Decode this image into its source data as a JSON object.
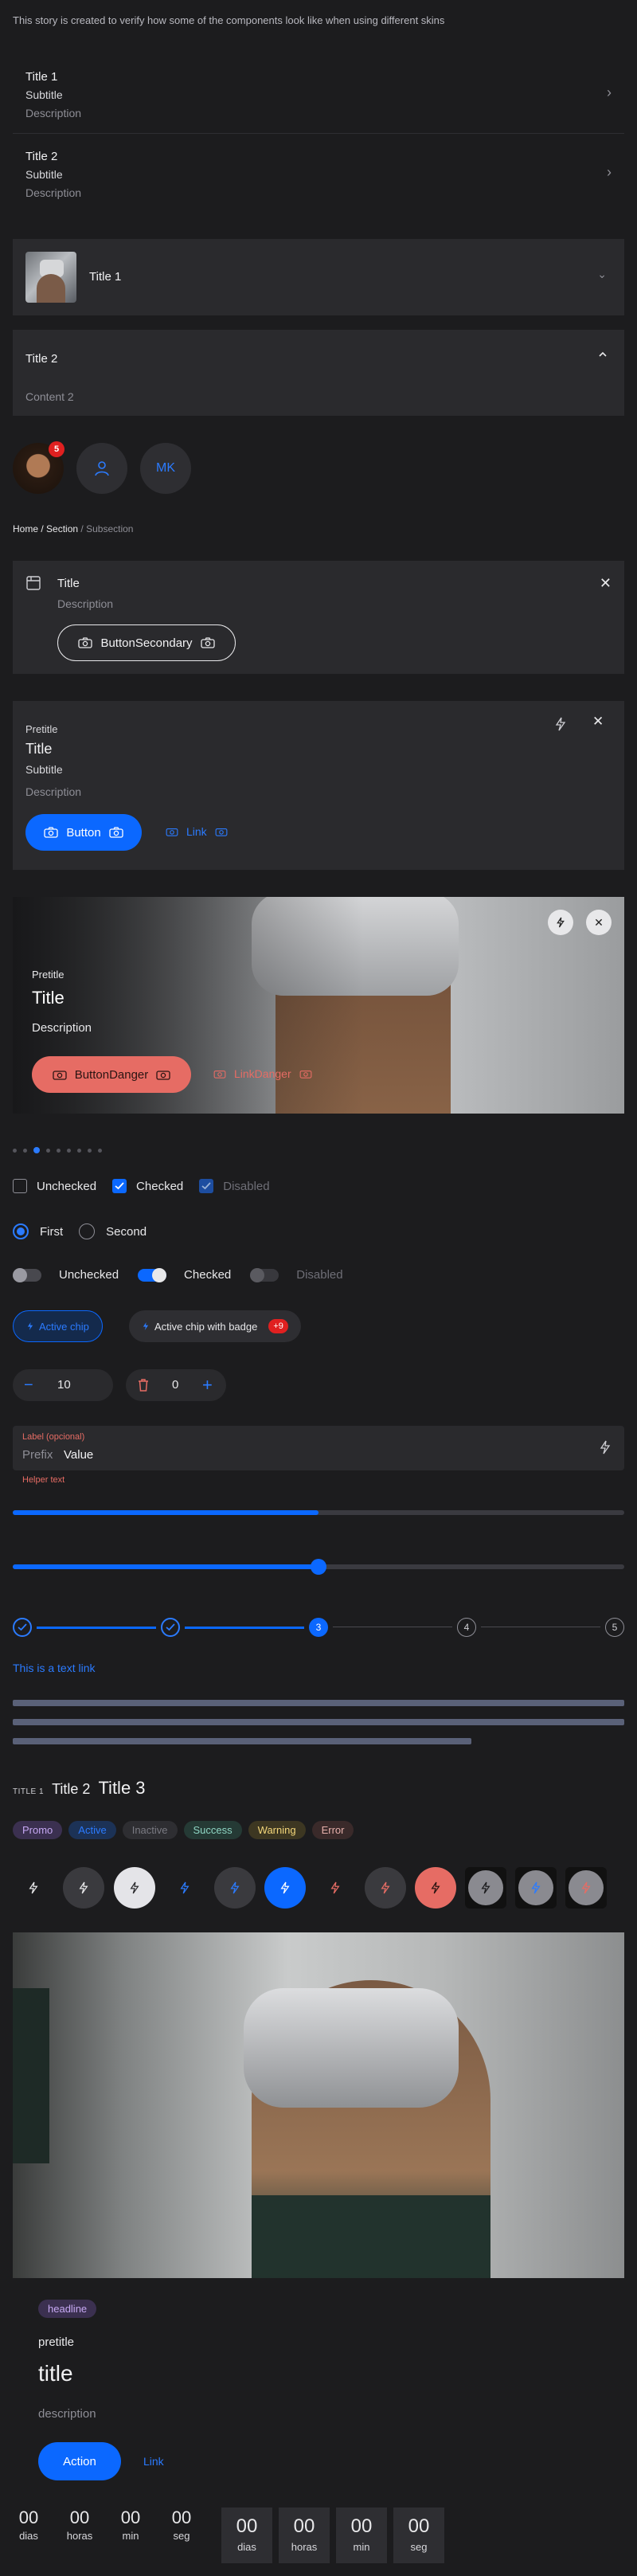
{
  "intro": "This story is created to verify how some of the components look like when using different skins",
  "rows": [
    {
      "title": "Title 1",
      "subtitle": "Subtitle",
      "description": "Description"
    },
    {
      "title": "Title 2",
      "subtitle": "Subtitle",
      "description": "Description"
    }
  ],
  "accordion": [
    {
      "title": "Title 1"
    },
    {
      "title": "Title 2",
      "content": "Content 2"
    }
  ],
  "avatars": {
    "badge": "5",
    "initials": "MK"
  },
  "breadcrumb": {
    "home": "Home",
    "section": "Section",
    "current": "Subsection",
    "sep": "/"
  },
  "callout": {
    "title": "Title",
    "description": "Description",
    "button": "ButtonSecondary"
  },
  "card": {
    "pretitle": "Pretitle",
    "title": "Title",
    "subtitle": "Subtitle",
    "description": "Description",
    "button": "Button",
    "link": "Link"
  },
  "media_card": {
    "pretitle": "Pretitle",
    "title": "Title",
    "description": "Description",
    "button": "ButtonDanger",
    "link": "LinkDanger"
  },
  "carousel": {
    "count": 9,
    "active": 2
  },
  "checkboxes": [
    {
      "label": "Unchecked",
      "checked": false,
      "disabled": false
    },
    {
      "label": "Checked",
      "checked": true,
      "disabled": false
    },
    {
      "label": "Disabled",
      "checked": true,
      "disabled": true
    }
  ],
  "radios": [
    {
      "label": "First",
      "checked": true
    },
    {
      "label": "Second",
      "checked": false
    }
  ],
  "switches": [
    {
      "label": "Unchecked",
      "on": false,
      "disabled": false
    },
    {
      "label": "Checked",
      "on": true,
      "disabled": false
    },
    {
      "label": "Disabled",
      "on": false,
      "disabled": true
    }
  ],
  "chips": {
    "active": "Active chip",
    "badge_label": "Active chip with badge",
    "badge": "+9"
  },
  "steppers": [
    {
      "value": "10"
    },
    {
      "value": "0"
    }
  ],
  "field": {
    "label": "Label (opcional)",
    "prefix": "Prefix",
    "value": "Value",
    "helper": "Helper text"
  },
  "progress": {
    "value": 0.5
  },
  "slider": {
    "value": 0.5
  },
  "steps": {
    "labels": [
      "",
      "",
      "3",
      "4",
      "5"
    ],
    "current": 3
  },
  "text_link": "This is a text link",
  "titles": {
    "t1": "TITLE 1",
    "t2": "Title 2",
    "t3": "Title 3"
  },
  "tags": [
    "Promo",
    "Active",
    "Inactive",
    "Success",
    "Warning",
    "Error"
  ],
  "hero": {
    "headline": "headline",
    "pretitle": "pretitle",
    "title": "title",
    "description": "description",
    "action": "Action",
    "link": "Link"
  },
  "countdown1": [
    {
      "value": "00",
      "unit": "dias"
    },
    {
      "value": "00",
      "unit": "horas"
    },
    {
      "value": "00",
      "unit": "min"
    },
    {
      "value": "00",
      "unit": "seg"
    }
  ],
  "countdown2": [
    {
      "value": "00",
      "unit": "dias"
    },
    {
      "value": "00",
      "unit": "horas"
    },
    {
      "value": "00",
      "unit": "min"
    },
    {
      "value": "00",
      "unit": "seg"
    }
  ],
  "colors": {
    "accent": "#0b68ff",
    "danger": "#e66c64",
    "background": "#1c1c1e",
    "surface": "#2a2a2d"
  }
}
